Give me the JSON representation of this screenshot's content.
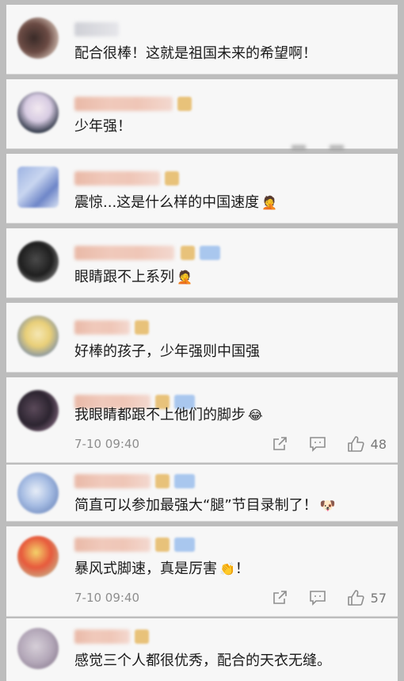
{
  "comments": [
    {
      "text": "配合很棒！这就是祖国未来的希望啊！",
      "emoji": ""
    },
    {
      "text": "少年强！",
      "emoji": ""
    },
    {
      "text": "震惊...这是什么样的中国速度",
      "emoji": "🤦"
    },
    {
      "text": "眼睛跟不上系列",
      "emoji": "🤦"
    },
    {
      "text": "好棒的孩子，少年强则中国强",
      "emoji": ""
    },
    {
      "text": "我眼睛都跟不上他们的脚步",
      "emoji": "😂",
      "time": "7-10 09:40",
      "likes": "48"
    },
    {
      "text": "简直可以参加最强大“腿”节目录制了！",
      "emoji": "🐶"
    },
    {
      "text": "暴风式脚速，真是厉害",
      "emoji": "👏",
      "suffix": "！",
      "time": "7-10 09:40",
      "likes": "57"
    },
    {
      "text": "感觉三个人都很优秀，配合的天衣无缝。",
      "emoji": ""
    }
  ],
  "colors": {
    "card_bg": "#f7f7f7",
    "page_bg": "#bdbdbd",
    "meta_gray": "#8e8e8e"
  }
}
